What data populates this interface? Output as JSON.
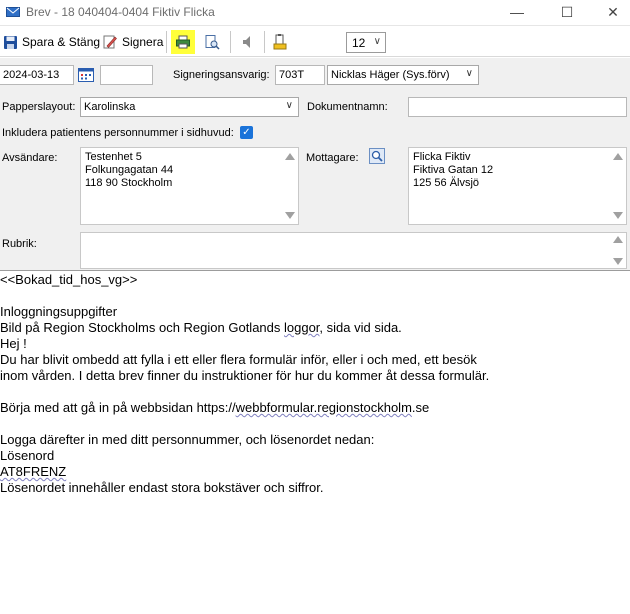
{
  "window": {
    "title": "Brev - 18 040404-0404 Fiktiv Flicka",
    "minimize": "—",
    "maximize": "☐",
    "close": "✕"
  },
  "toolbar": {
    "save_close_label": "Spara & Stäng",
    "sign_label": "Signera",
    "font_size": "12",
    "icons": [
      "save-icon",
      "sign-icon",
      "print-icon",
      "print-preview-icon",
      "speaker-icon",
      "paste-icon"
    ],
    "highlight_color": "#ffff3a"
  },
  "form": {
    "date": "2024-03-13",
    "time_value": "",
    "sign_label": "Signeringsansvarig:",
    "sign_code": "703T",
    "sign_name": "Nicklas Häger (Sys.förv)",
    "paper_layout_label": "Papperslayout:",
    "paper_layout_value": "Karolinska",
    "document_name_label": "Dokumentnamn:",
    "document_name_value": "",
    "include_pnr_label": "Inkludera patientens personnummer i sidhuvud:",
    "include_pnr_checked": true,
    "sender_label": "Avsändare:",
    "sender_lines": [
      "Testenhet 5",
      "Folkungagatan 44",
      "118 90 Stockholm"
    ],
    "recipient_label": "Mottagare:",
    "recipient_lines": [
      "Flicka Fiktiv",
      "Fiktiva Gatan 12",
      "125 56 Älvsjö"
    ],
    "subject_label": "Rubrik:",
    "subject_value": ""
  },
  "letter": {
    "l1": "<<Bokad_tid_hos_vg>>",
    "l2": "",
    "l3": "Inloggningsuppgifter",
    "l4a": "Bild på Region Stockholms och Region Gotlands ",
    "l4b": "loggor",
    "l4c": ", sida vid sida.",
    "l5": "Hej !",
    "l6": "Du har blivit ombedd att fylla i ett eller flera formulär inför, eller i och med, ett besök",
    "l7": "inom vården. I detta brev finner du instruktioner för hur du kommer åt dessa formulär.",
    "l8": "",
    "l9a": "Börja med att gå in på webbsidan https://",
    "l9b": "webbformular.regionstockholm",
    "l9c": ".se",
    "l10": "",
    "l11": "Logga därefter in med ditt personnummer, och lösenordet nedan:",
    "l12": "Lösenord",
    "l13": "AT8FRENZ",
    "l14": "Lösenordet innehåller endast stora bokstäver och siffror."
  }
}
